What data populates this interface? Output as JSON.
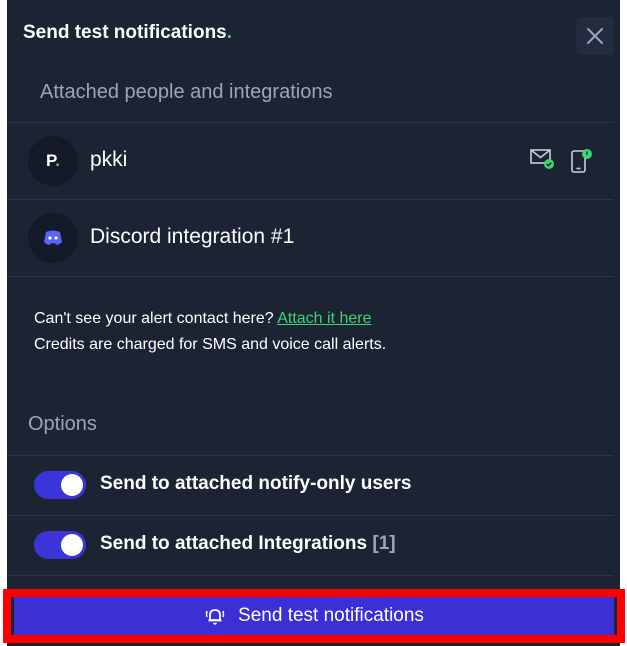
{
  "modal": {
    "title": "Send test notifications",
    "title_dot": "."
  },
  "attached": {
    "label": "Attached people and integrations",
    "items": [
      {
        "avatar": "P",
        "avatar_dot": ".",
        "name": "pkki",
        "icons": [
          "email-check-icon",
          "phone-notification-icon"
        ]
      },
      {
        "avatar_icon": "discord-icon",
        "name": "Discord integration #1"
      }
    ]
  },
  "notice": {
    "line1": "Can't see your alert contact here? ",
    "link": "Attach it here",
    "line2": "Credits are charged for SMS and voice call alerts."
  },
  "options": {
    "label": "Options",
    "toggles": [
      {
        "label": "Send to attached notify-only users",
        "on": true
      },
      {
        "label": "Send to attached Integrations",
        "count": "[1]",
        "on": true
      }
    ]
  },
  "footer": {
    "button_label": "Send test notifications",
    "button_icon": "bell-ring-icon"
  },
  "colors": {
    "panel_bg": "#1c2332",
    "accent_green": "#3bd671",
    "button_blue": "#3b2fd6",
    "highlight_red": "#ff0000"
  }
}
